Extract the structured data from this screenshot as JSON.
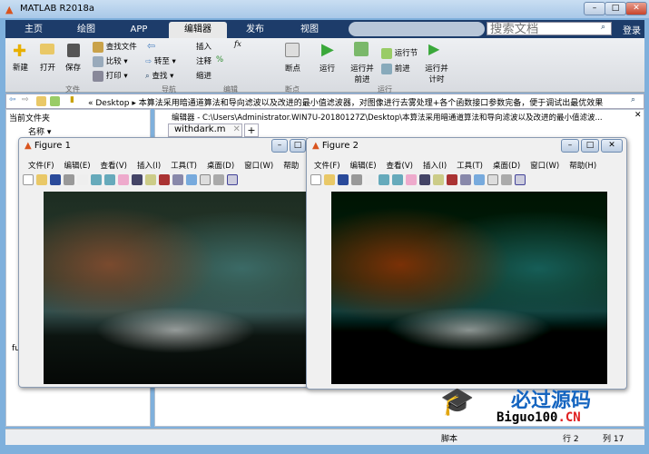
{
  "app": {
    "title": "MATLAB R2018a"
  },
  "tabs": [
    "主页",
    "绘图",
    "APP",
    "编辑器",
    "发布",
    "视图"
  ],
  "active_tab": "编辑器",
  "search": {
    "placeholder": "搜索文档"
  },
  "login": "登录",
  "ribbon": {
    "file": {
      "new": "新建",
      "open": "打开",
      "save": "保存",
      "find_files": "查找文件",
      "compare": "比较",
      "print": "打印",
      "group": "文件"
    },
    "nav": {
      "goto": "转至",
      "find": "查找",
      "group": "导航"
    },
    "edit": {
      "insert": "插入",
      "comment": "注释",
      "indent": "缩进",
      "fx": "fx",
      "group": "编辑"
    },
    "breakpoints": {
      "label": "断点",
      "group": "断点"
    },
    "run": {
      "run": "运行",
      "run_advance": "运行并前进",
      "run_section": "运行节",
      "advance": "前进",
      "run_time": "运行并计时",
      "group": "运行"
    }
  },
  "address": {
    "root": "Desktop",
    "path": "本算法采用暗通道算法和导向滤波以及改进的最小值滤波器，对图像进行去雾处理+各个函数接口参数完备，便于调试出最优效果"
  },
  "current_folder": {
    "title": "当前文件夹",
    "col_name": "名称",
    "item": "fu"
  },
  "editor": {
    "title": "编辑器 - C:\\Users\\Administrator.WIN7U-20180127Z\\Desktop\\本算法采用暗通道算法和导向滤波以及改进的最小值滤波...",
    "tab": "withdark.m",
    "add": "+"
  },
  "figure1": {
    "title": "Figure 1",
    "menu": [
      "文件(F)",
      "编辑(E)",
      "查看(V)",
      "插入(I)",
      "工具(T)",
      "桌面(D)",
      "窗口(W)",
      "帮助"
    ]
  },
  "figure2": {
    "title": "Figure 2",
    "menu": [
      "文件(F)",
      "编辑(E)",
      "查看(V)",
      "插入(I)",
      "工具(T)",
      "桌面(D)",
      "窗口(W)",
      "帮助(H)"
    ]
  },
  "watermark": {
    "cn": "必过源码",
    "en": "Biguo100",
    "tld": ".CN"
  },
  "status": {
    "mode": "脚本",
    "row_label": "行",
    "row": "2",
    "col_label": "列",
    "col": "17"
  },
  "colors": {
    "tabbar": "#1d3c6a",
    "accent": "#1565c0",
    "watermark_red": "#e02020"
  }
}
